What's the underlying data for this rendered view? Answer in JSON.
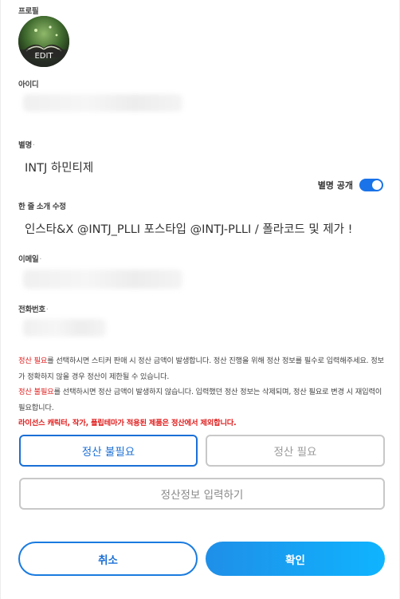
{
  "profile": {
    "label": "프로필",
    "edit_label": "EDIT"
  },
  "id_field": {
    "label": "아이디"
  },
  "nickname": {
    "label": "별명",
    "required_mark": "·",
    "value": "INTJ 하민티제"
  },
  "nickname_public": {
    "label": "별명 공개",
    "on": true
  },
  "intro": {
    "label": "한 줄 소개 수정",
    "value": "인스타&X @INTJ_PLLI 포스타입 @INTJ-PLLI / 폴라코드 및 제가 !"
  },
  "email": {
    "label": "이메일",
    "required_mark": "·"
  },
  "phone": {
    "label": "전화번호",
    "required_mark": "·"
  },
  "notes": {
    "line1_red": "정산 필요",
    "line1_rest": "를 선택하시면 스티커 판매 시 정산 금액이 발생합니다. 정산 진행을 위해 정산 정보를 필수로 입력해주세요. 정보가 정확하지 않을 경우 정산이 제한될 수 있습니다.",
    "line2_red": "정산 불필요",
    "line2_rest": "를 선택하시면 정산 금액이 발생하지 않습니다. 입력했던 정산 정보는 삭제되며, 정산 필요로 변경 시 재입력이 필요합니다.",
    "line3": "라이선스 캐릭터, 작가, 폴립테마가 적용된 제품은 정산에서 제외합니다."
  },
  "settlement": {
    "unneeded_label": "정산 불필요",
    "needed_label": "정산 필요",
    "selected": "정산 불필요",
    "enter_info_label": "정산정보 입력하기"
  },
  "actions": {
    "cancel_label": "취소",
    "confirm_label": "확인"
  },
  "colors": {
    "accent": "#1a6fd6",
    "warning": "#e02020",
    "toggle": "#1a73e8"
  }
}
